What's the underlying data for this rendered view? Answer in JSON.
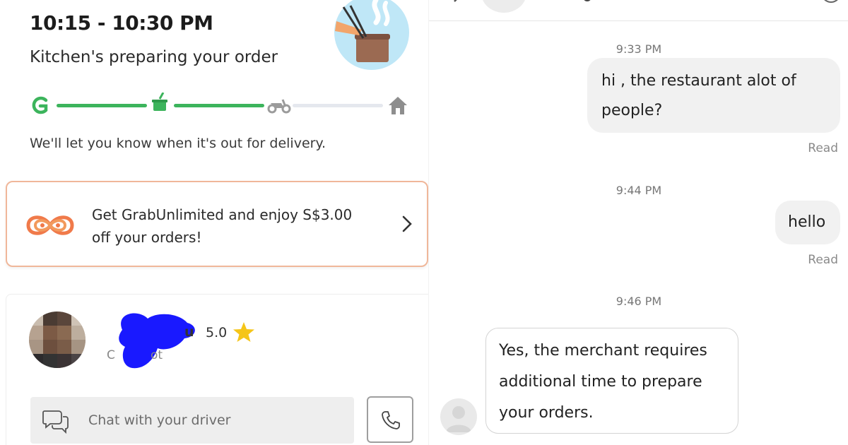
{
  "order": {
    "eta": "10:15 - 10:30 PM",
    "status": "Kitchen's preparing your order",
    "hint": "We'll let you know when it's out for delivery."
  },
  "tracker": {
    "steps": [
      "grab-logo-icon",
      "cooking-pot-icon",
      "scooter-icon",
      "home-icon"
    ],
    "active_color": "#3cb45c",
    "inactive_color": "#e5e8ee",
    "progress_step": 2
  },
  "promo": {
    "text": "Get GrabUnlimited and enjoy S$3.00 off your orders!",
    "accent": "#f07a4a"
  },
  "driver": {
    "name_suffix": "u",
    "rating": "5.0",
    "plate_prefix": "C",
    "plate_suffix": "ot"
  },
  "chat_input": {
    "placeholder": "Chat with your driver"
  },
  "messages": {
    "m1": {
      "time": "9:33 PM",
      "text_line1": "hi , the restaurant alot of",
      "text_line2": "people?",
      "receipt": "Read"
    },
    "m2": {
      "time": "9:44 PM",
      "text": "hello",
      "receipt": "Read"
    },
    "m3": {
      "time": "9:46 PM",
      "line1": "Yes, the merchant requires",
      "line2": "additional time to prepare",
      "line3": "your orders."
    }
  },
  "colors": {
    "brand_green": "#3cb45c",
    "outgoing_bubble": "#f1f1f1",
    "star": "#f5c518"
  }
}
